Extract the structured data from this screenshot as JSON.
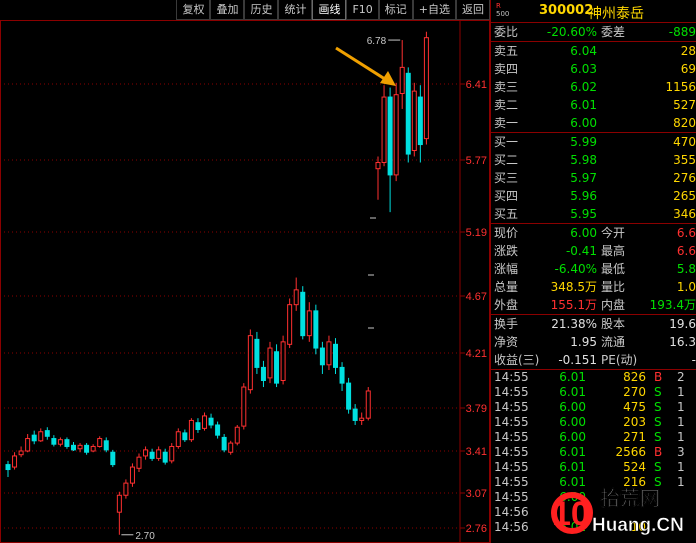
{
  "toolbar": {
    "buttons": [
      "复权",
      "叠加",
      "历史",
      "统计",
      "画线",
      "F10",
      "标记",
      "+自选",
      "返回"
    ],
    "active_index": 4
  },
  "stock": {
    "r500_line1": "R",
    "r500_line2": "500",
    "code": "300002",
    "name": "神州泰岳"
  },
  "colors": {
    "up": "#ff3030",
    "down": "#00e0e0",
    "price_up": "#ff3030",
    "price_down": "#00e000",
    "volume": "#ffd700",
    "grid": "#8b0000",
    "axis_text": "#ff3030",
    "arrow": "#f0a000"
  },
  "chart_data": {
    "type": "candlestick",
    "y_ticks": [
      "6.41",
      "5.77",
      "5.19",
      "4.67",
      "4.21",
      "3.79",
      "3.41",
      "3.07",
      "2.76"
    ],
    "annotations": {
      "high_label": "6.78",
      "low_label": "2.70",
      "current_label": "6.00"
    },
    "candles": [
      [
        3.3,
        3.26,
        3.33,
        3.2
      ],
      [
        3.28,
        3.37,
        3.4,
        3.26
      ],
      [
        3.38,
        3.41,
        3.45,
        3.36
      ],
      [
        3.41,
        3.52,
        3.56,
        3.4
      ],
      [
        3.55,
        3.5,
        3.59,
        3.47
      ],
      [
        3.5,
        3.58,
        3.61,
        3.49
      ],
      [
        3.59,
        3.54,
        3.62,
        3.51
      ],
      [
        3.52,
        3.47,
        3.55,
        3.45
      ],
      [
        3.47,
        3.51,
        3.53,
        3.45
      ],
      [
        3.51,
        3.45,
        3.53,
        3.43
      ],
      [
        3.46,
        3.42,
        3.49,
        3.41
      ],
      [
        3.43,
        3.46,
        3.48,
        3.4
      ],
      [
        3.46,
        3.4,
        3.48,
        3.38
      ],
      [
        3.41,
        3.45,
        3.47,
        3.4
      ],
      [
        3.45,
        3.52,
        3.54,
        3.44
      ],
      [
        3.5,
        3.42,
        3.53,
        3.4
      ],
      [
        3.4,
        3.3,
        3.42,
        3.28
      ],
      [
        2.9,
        3.05,
        3.08,
        2.7
      ],
      [
        3.05,
        3.15,
        3.18,
        3.02
      ],
      [
        3.15,
        3.28,
        3.31,
        3.12
      ],
      [
        3.27,
        3.36,
        3.39,
        3.24
      ],
      [
        3.37,
        3.42,
        3.45,
        3.34
      ],
      [
        3.4,
        3.35,
        3.43,
        3.33
      ],
      [
        3.35,
        3.42,
        3.45,
        3.33
      ],
      [
        3.4,
        3.32,
        3.43,
        3.3
      ],
      [
        3.33,
        3.45,
        3.48,
        3.31
      ],
      [
        3.45,
        3.58,
        3.61,
        3.43
      ],
      [
        3.57,
        3.51,
        3.6,
        3.49
      ],
      [
        3.51,
        3.68,
        3.7,
        3.49
      ],
      [
        3.66,
        3.6,
        3.7,
        3.57
      ],
      [
        3.61,
        3.72,
        3.75,
        3.59
      ],
      [
        3.7,
        3.64,
        3.74,
        3.61
      ],
      [
        3.64,
        3.55,
        3.67,
        3.52
      ],
      [
        3.53,
        3.42,
        3.56,
        3.4
      ],
      [
        3.4,
        3.48,
        3.5,
        3.38
      ],
      [
        3.48,
        3.62,
        3.64,
        3.46
      ],
      [
        3.63,
        3.95,
        3.98,
        3.6
      ],
      [
        3.93,
        4.35,
        4.4,
        3.9
      ],
      [
        4.32,
        4.1,
        4.38,
        4.05
      ],
      [
        4.1,
        4.0,
        4.15,
        3.95
      ],
      [
        4.02,
        4.25,
        4.3,
        3.98
      ],
      [
        4.22,
        3.98,
        4.28,
        3.95
      ],
      [
        4.0,
        4.3,
        4.35,
        3.97
      ],
      [
        4.28,
        4.6,
        4.65,
        4.25
      ],
      [
        4.6,
        4.72,
        4.82,
        4.55
      ],
      [
        4.7,
        4.35,
        4.75,
        4.32
      ],
      [
        4.35,
        4.55,
        4.62,
        4.3
      ],
      [
        4.55,
        4.25,
        4.6,
        4.2
      ],
      [
        4.25,
        4.12,
        4.3,
        4.05
      ],
      [
        4.12,
        4.3,
        4.35,
        4.08
      ],
      [
        4.28,
        4.1,
        4.33,
        4.05
      ],
      [
        4.1,
        3.98,
        4.14,
        3.92
      ],
      [
        3.98,
        3.78,
        4.02,
        3.74
      ],
      [
        3.78,
        3.68,
        3.82,
        3.64
      ],
      [
        3.68,
        3.7,
        3.75,
        3.64
      ],
      [
        3.7,
        3.92,
        3.95,
        3.68
      ],
      [
        5.7,
        5.75,
        5.8,
        5.45
      ],
      [
        5.75,
        6.3,
        6.4,
        5.72
      ],
      [
        6.3,
        5.65,
        6.38,
        5.35
      ],
      [
        5.65,
        6.32,
        6.42,
        5.6
      ],
      [
        6.33,
        6.55,
        6.78,
        6.2
      ],
      [
        6.5,
        5.82,
        6.55,
        5.75
      ],
      [
        5.85,
        6.35,
        6.42,
        5.8
      ],
      [
        6.3,
        5.9,
        6.4,
        5.75
      ],
      [
        5.95,
        6.8,
        6.85,
        5.9
      ]
    ]
  },
  "quote": {
    "weibi_label": "委比",
    "weibi_value": "-20.60%",
    "weicha_label": "委差",
    "weicha_value": "-889",
    "asks": [
      {
        "label": "卖五",
        "price": "6.04",
        "vol": "28"
      },
      {
        "label": "卖四",
        "price": "6.03",
        "vol": "69"
      },
      {
        "label": "卖三",
        "price": "6.02",
        "vol": "1156"
      },
      {
        "label": "卖二",
        "price": "6.01",
        "vol": "527"
      },
      {
        "label": "卖一",
        "price": "6.00",
        "vol": "820"
      }
    ],
    "bids": [
      {
        "label": "买一",
        "price": "5.99",
        "vol": "470"
      },
      {
        "label": "买二",
        "price": "5.98",
        "vol": "355"
      },
      {
        "label": "买三",
        "price": "5.97",
        "vol": "276"
      },
      {
        "label": "买四",
        "price": "5.96",
        "vol": "265"
      },
      {
        "label": "买五",
        "price": "5.95",
        "vol": "346"
      }
    ],
    "stats1": [
      {
        "l1": "现价",
        "v1": "6.00",
        "c1": "green",
        "l2": "今开",
        "v2": "6.6",
        "c2": "red"
      },
      {
        "l1": "涨跌",
        "v1": "-0.41",
        "c1": "green",
        "l2": "最高",
        "v2": "6.6",
        "c2": "red"
      },
      {
        "l1": "涨幅",
        "v1": "-6.40%",
        "c1": "green",
        "l2": "最低",
        "v2": "5.8",
        "c2": "green"
      },
      {
        "l1": "总量",
        "v1": "348.5万",
        "c1": "yellow",
        "l2": "量比",
        "v2": "1.0",
        "c2": "yellow"
      },
      {
        "l1": "外盘",
        "v1": "155.1万",
        "c1": "red",
        "l2": "内盘",
        "v2": "193.4万",
        "c2": "green"
      }
    ],
    "stats2": [
      {
        "l1": "换手",
        "v1": "21.38%",
        "c1": "white",
        "l2": "股本",
        "v2": "19.6",
        "c2": "white"
      },
      {
        "l1": "净资",
        "v1": "1.95",
        "c1": "white",
        "l2": "流通",
        "v2": "16.3",
        "c2": "white"
      },
      {
        "l1": "收益(三)",
        "v1": "-0.151",
        "c1": "white",
        "l2": "PE(动)",
        "v2": "-",
        "c2": "white"
      }
    ]
  },
  "ticks": [
    {
      "time": "14:55",
      "price": "6.01",
      "vol": "826",
      "bs": "B",
      "n": "2"
    },
    {
      "time": "14:55",
      "price": "6.01",
      "vol": "270",
      "bs": "S",
      "n": "1"
    },
    {
      "time": "14:55",
      "price": "6.00",
      "vol": "475",
      "bs": "S",
      "n": "1"
    },
    {
      "time": "14:55",
      "price": "6.00",
      "vol": "203",
      "bs": "S",
      "n": "1"
    },
    {
      "time": "14:55",
      "price": "6.00",
      "vol": "271",
      "bs": "S",
      "n": "1"
    },
    {
      "time": "14:55",
      "price": "6.01",
      "vol": "2566",
      "bs": "B",
      "n": "3"
    },
    {
      "time": "14:55",
      "price": "6.01",
      "vol": "524",
      "bs": "S",
      "n": "1"
    },
    {
      "time": "14:55",
      "price": "6.01",
      "vol": "216",
      "bs": "S",
      "n": "1"
    },
    {
      "time": "14:55",
      "price": "6.00",
      "vol": "",
      "bs": "",
      "n": ""
    },
    {
      "time": "14:56",
      "price": "",
      "vol": "",
      "bs": "",
      "n": ""
    },
    {
      "time": "14:56",
      "price": "6.01",
      "vol": "10",
      "bs": "",
      "n": ""
    }
  ],
  "watermark": {
    "number": "10",
    "cn": "拾荒网",
    "url": "Huang.CN"
  }
}
